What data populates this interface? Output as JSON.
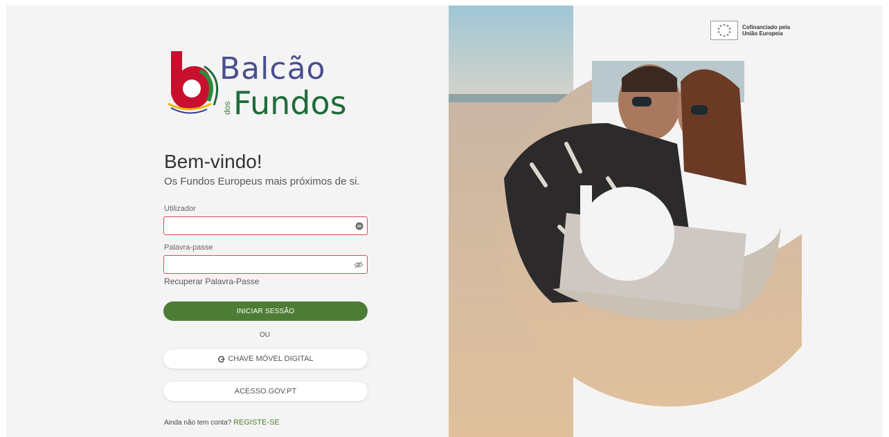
{
  "brand": {
    "name_top": "Balcão",
    "name_small": "dos",
    "name_bottom": "Fundos"
  },
  "welcome": {
    "title": "Bem-vindo!",
    "subtitle": "Os Fundos Europeus mais próximos de si."
  },
  "form": {
    "username_label": "Utilizador",
    "username_value": "",
    "password_label": "Palavra-passe",
    "password_value": "",
    "recover_link": "Recuperar Palavra-Passe",
    "login_button": "INICIAR SESSÃO",
    "or_text": "OU",
    "cmd_button": "CHAVE MÓVEL DIGITAL",
    "gov_button": "ACESSO.GOV.PT",
    "register_prompt": "Ainda não tem conta?",
    "register_link": "REGISTE-SE"
  },
  "eu": {
    "line1": "Cofinanciado pela",
    "line2": "União Europeia"
  },
  "colors": {
    "accent_green": "#4d7d35",
    "field_border": "#e0475a",
    "logo_blue": "#4a4f8e",
    "logo_green": "#1f6b3a"
  },
  "icons": [
    "user-card-icon",
    "eye-icon",
    "cmd-key-icon",
    "eu-flag-icon"
  ]
}
